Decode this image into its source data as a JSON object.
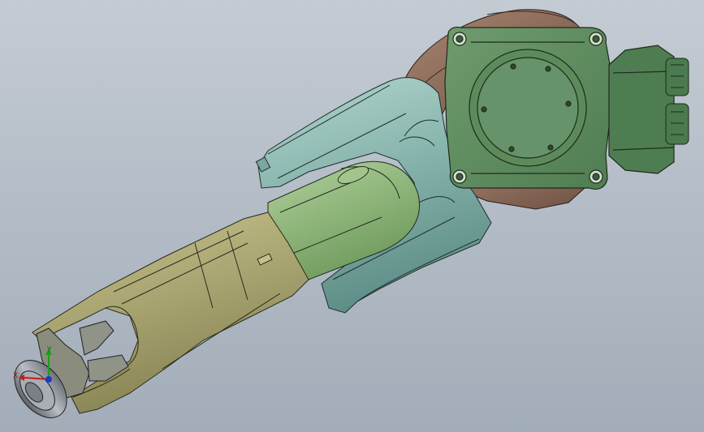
{
  "viewport": {
    "background_top": "#c4cbd3",
    "background_bottom": "#a2adb9"
  },
  "model": {
    "colors": {
      "base_green": "#5e8a5e",
      "base_green_dark": "#3f6a46",
      "upper_arm_teal": "#86b4ac",
      "forearm_khaki": "#a8a772",
      "inner_link_green": "#93b77f",
      "brown_joint": "#8b6a58",
      "edge": "#1e2a22"
    }
  },
  "triad": {
    "x_label": "X",
    "y_label": "Y",
    "x_color": "#cc1a1a",
    "y_color": "#18a018",
    "z_color": "#1a3acc"
  }
}
